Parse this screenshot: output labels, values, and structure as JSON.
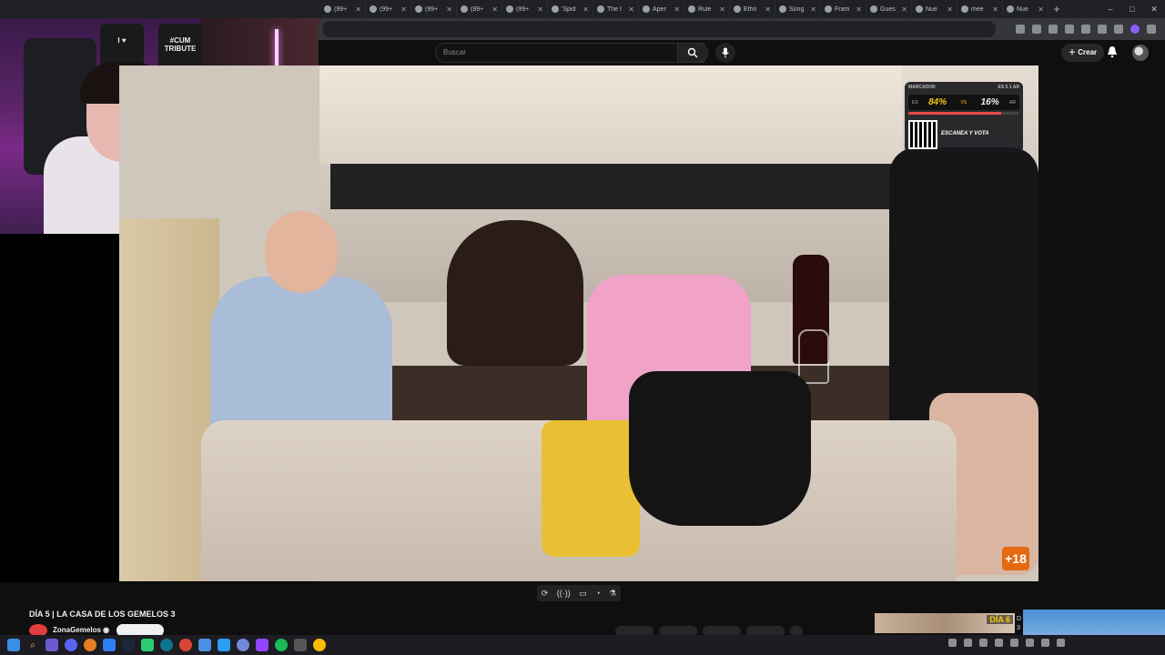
{
  "browser": {
    "tabs": [
      {
        "label": "(99+",
        "icon": "tiktok-icon"
      },
      {
        "label": "(99+",
        "icon": "tiktok-icon"
      },
      {
        "label": "(99+",
        "icon": "tiktok-icon"
      },
      {
        "label": "(99+",
        "icon": "tiktok-icon"
      },
      {
        "label": "(99+",
        "icon": "tiktok-icon"
      },
      {
        "label": "'Spid",
        "icon": "globe-icon"
      },
      {
        "label": "The I",
        "icon": "globe-icon"
      },
      {
        "label": "Aper",
        "icon": "globe-icon"
      },
      {
        "label": "Rule",
        "icon": "globe-icon"
      },
      {
        "label": "Ethn",
        "icon": "globe-icon"
      },
      {
        "label": "Song",
        "icon": "google-icon"
      },
      {
        "label": "Fram",
        "icon": "youtube-icon"
      },
      {
        "label": "Gues",
        "icon": "globe-icon"
      },
      {
        "label": "Nue",
        "icon": "globe-icon"
      },
      {
        "label": "mee",
        "icon": "globe-icon"
      },
      {
        "label": "Nue",
        "icon": "globe-icon"
      }
    ],
    "new_tab": "+",
    "window_controls": [
      "–",
      "□",
      "✕"
    ]
  },
  "youtube": {
    "search_placeholder": "Buscar",
    "create_label": "Crear",
    "video_title": "DÍA 5 | LA CASA DE LOS GEMELOS 3",
    "channel_name": "ZonaGemelos",
    "verified_icon": "verified-icon",
    "rating_badge": "+18",
    "overlay": {
      "title": "MARCADOR",
      "meta_left": "ES 5",
      "meta_right": "1 AR",
      "left_label": "ES",
      "left_pct": "84%",
      "vs": "VS",
      "right_pct": "16%",
      "right_label": "AR",
      "left_share": 0.84,
      "scan_text": "ESCANEA Y VOTA"
    },
    "controls": [
      "⟳",
      "((·))",
      "▭",
      "◔",
      "⚗"
    ],
    "suggested": {
      "thumb1_badge": "DÍA 6",
      "meta_line1": "D",
      "meta_line2": "3"
    }
  },
  "webcam": {
    "shirt1": "I ♥",
    "shirt2": "#CUM TRIBUTE"
  },
  "colors": {
    "accent": "#f5c518",
    "rating": "#e36a12"
  }
}
